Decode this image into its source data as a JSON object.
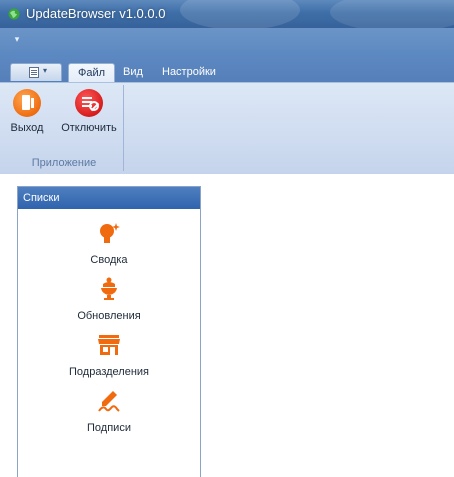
{
  "window": {
    "title": "UpdateBrowser v1.0.0.0",
    "icon": "app-globe-icon"
  },
  "quick_access": {
    "menu_icon": "dropdown-arrow-icon"
  },
  "tabs": [
    {
      "label": "Файл",
      "active": true
    },
    {
      "label": "Вид",
      "active": false
    },
    {
      "label": "Настройки",
      "active": false
    }
  ],
  "ribbon": {
    "group_caption": "Приложение",
    "buttons": [
      {
        "label": "Выход",
        "icon": "exit-door-icon"
      },
      {
        "label": "Отключить",
        "icon": "disable-icon"
      }
    ]
  },
  "panel": {
    "title": "Списки",
    "items": [
      {
        "label": "Сводка",
        "icon": "summary-icon"
      },
      {
        "label": "Обновления",
        "icon": "updates-icon"
      },
      {
        "label": "Подразделения",
        "icon": "departments-icon"
      },
      {
        "label": "Подписи",
        "icon": "signatures-icon"
      }
    ]
  },
  "colors": {
    "accent": "#f06a10",
    "header_blue": "#2f63ad",
    "disable_red": "#d71c1c"
  }
}
